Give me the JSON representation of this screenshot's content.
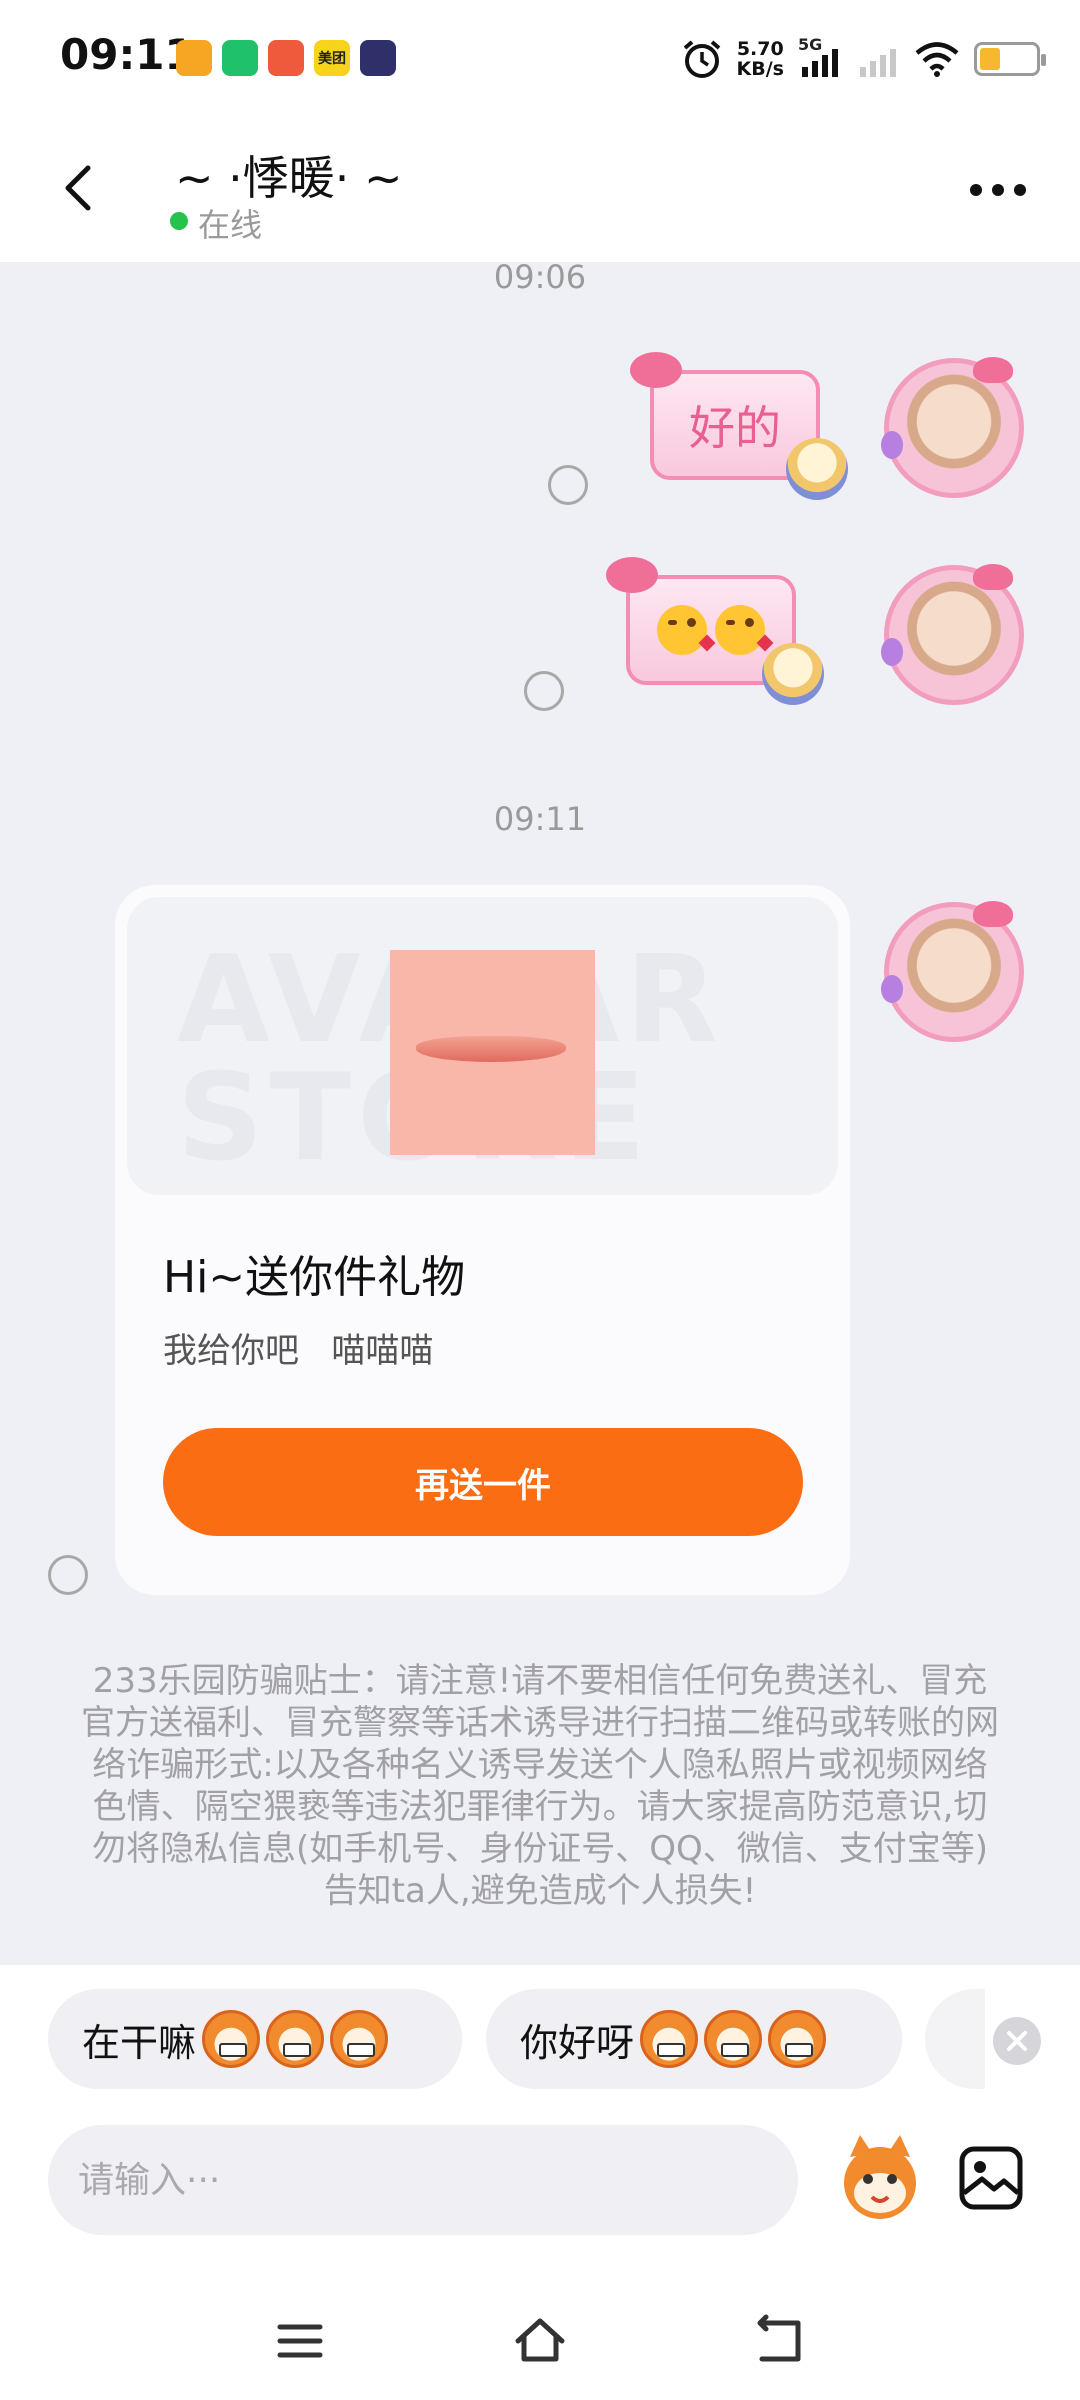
{
  "status_bar": {
    "time": "09:11",
    "app_icons": [
      "memo-app-icon",
      "video-app-icon",
      "game-app-icon",
      "meituan-app-icon",
      "player-app-icon"
    ],
    "app_icon_colors": [
      "#f6a623",
      "#1fc16b",
      "#f05a3c",
      "#f8d31c",
      "#2f2f6a"
    ],
    "meituan_label": "美团",
    "network_speed": "5.70",
    "network_speed_unit": "KB/s",
    "network_type": "5G",
    "battery_level": 0.35
  },
  "header": {
    "contact_name": "~ ·悸暖· ~",
    "status": "在线"
  },
  "chat": {
    "time_1": "09:06",
    "sticker_1_text": "好的",
    "sticker_2_emoji": [
      "kissing-face-emoji",
      "kissing-face-emoji"
    ],
    "time_2": "09:11",
    "gift_card": {
      "watermark": "AVATAR\nSTORE",
      "title": "Hi~送你件礼物",
      "subtitle": "我给你吧   喵喵喵",
      "button_label": "再送一件"
    },
    "safety_tip": "233乐园防骗贴士：请注意!请不要相信任何免费送礼、冒充官方送福利、冒充警察等话术诱导进行扫描二维码或转账的网络诈骗形式:以及各种名义诱导发送个人隐私照片或视频网络色情、隔空猥亵等违法犯罪律行为。请大家提高防范意识,切勿将隐私信息(如手机号、身份证号、QQ、微信、支付宝等)告知ta人,避免造成个人损失!"
  },
  "quick_replies": [
    {
      "label": "在干嘛"
    },
    {
      "label": "你好呀"
    }
  ],
  "composer": {
    "placeholder": "请输入···"
  },
  "colors": {
    "accent": "#fb6d13",
    "online": "#27c24c",
    "background": "#eff0f6"
  }
}
